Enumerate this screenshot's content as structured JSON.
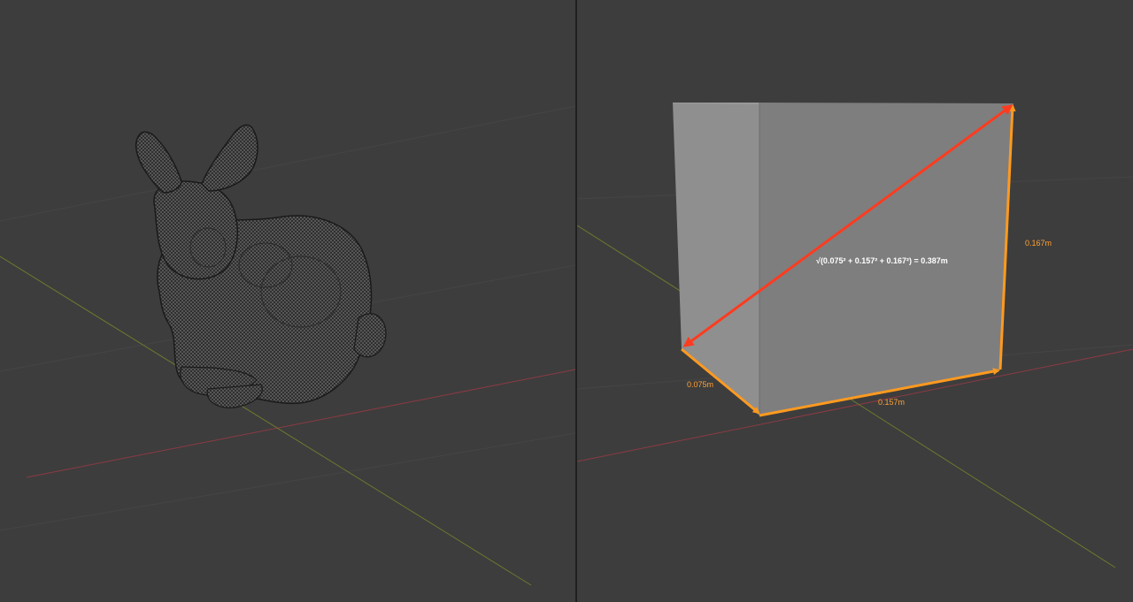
{
  "viewports": {
    "left": {
      "object": "stanford-bunny-mesh"
    },
    "right": {
      "object": "box-mesh",
      "measurements": {
        "depth": "0.075m",
        "width": "0.157m",
        "height": "0.167m",
        "diagonal_formula": "√(0.075² + 0.157² + 0.167²) = 0.387m"
      }
    }
  },
  "colors": {
    "viewport_bg": "#3d3d3d",
    "axis_x": "#8b3a44",
    "axis_y": "#6b7a2f",
    "grid": "#454545",
    "measure_orange": "#ff9a1f",
    "measure_red": "#ff3b1f",
    "box_front": "#7e7e7e",
    "box_side": "#8f8f8f",
    "bunny": "#5a5a5a"
  }
}
